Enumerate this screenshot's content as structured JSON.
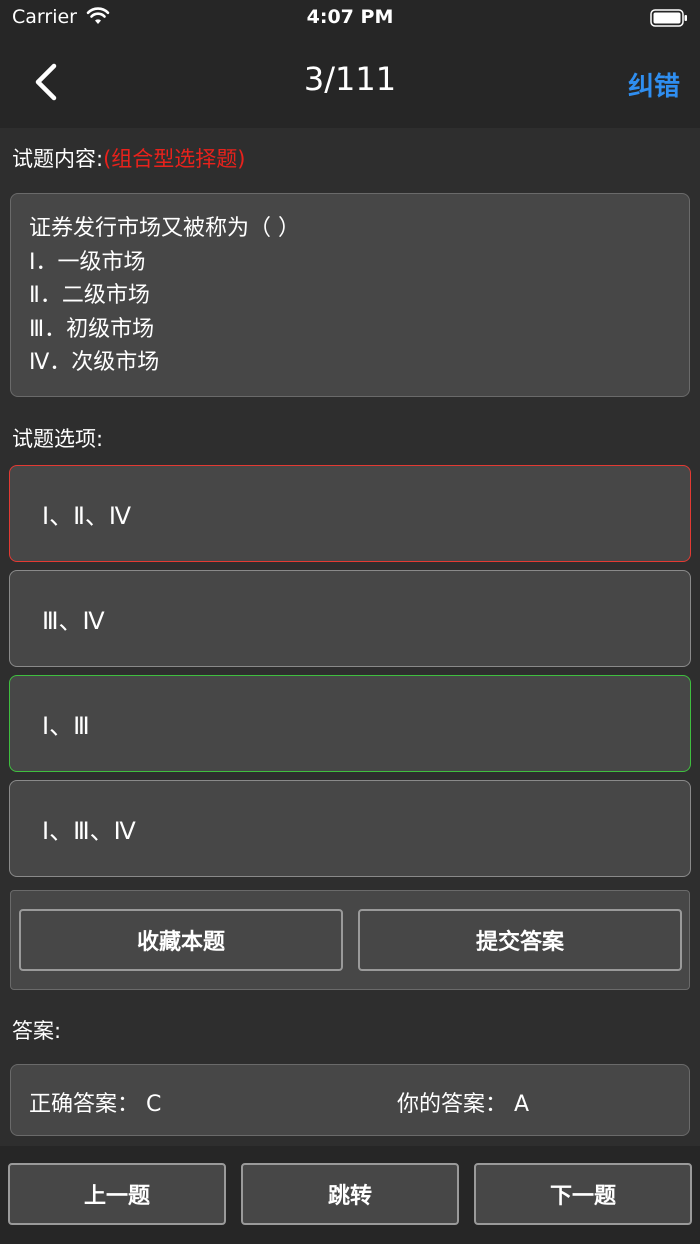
{
  "status_bar": {
    "carrier": "Carrier",
    "time": "4:07 PM"
  },
  "nav": {
    "title": "3/111",
    "report_label": "纠错"
  },
  "question": {
    "label": "试题内容:",
    "type": "(组合型选择题)",
    "lines": [
      "证券发行市场又被称为（ ）",
      "Ⅰ．一级市场",
      "Ⅱ．二级市场",
      "Ⅲ．初级市场",
      "Ⅳ．次级市场"
    ]
  },
  "options": {
    "label": "试题选项:",
    "items": [
      {
        "text": "Ⅰ、Ⅱ、Ⅳ",
        "state": "wrong"
      },
      {
        "text": "Ⅲ、Ⅳ",
        "state": "normal"
      },
      {
        "text": "Ⅰ、Ⅲ",
        "state": "correct"
      },
      {
        "text": "Ⅰ、Ⅲ、Ⅳ",
        "state": "normal"
      }
    ]
  },
  "actions": {
    "favorite_label": "收藏本题",
    "submit_label": "提交答案"
  },
  "answer": {
    "label": "答案:",
    "correct_text": "正确答案： C",
    "yours_text": "你的答案： A"
  },
  "bottom_nav": {
    "prev_label": "上一题",
    "jump_label": "跳转",
    "next_label": "下一题"
  },
  "colors": {
    "accent": "#2f8ef0",
    "wrong": "#e33a33",
    "correct": "#3fbf3f",
    "question_type": "#e8221c"
  }
}
